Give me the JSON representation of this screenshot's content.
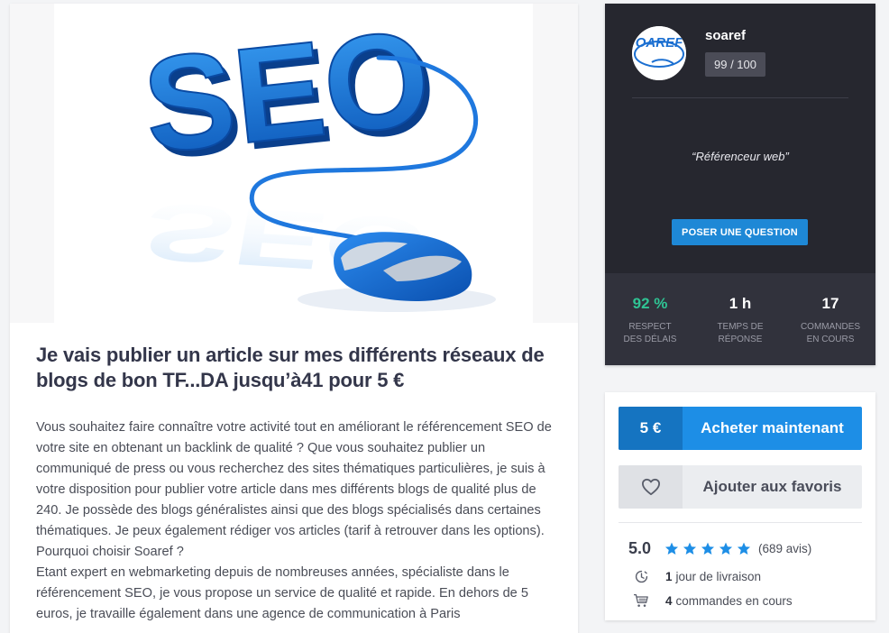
{
  "gig": {
    "image_text": "SEO",
    "title": "Je vais publier un article sur mes différents réseaux de blogs de bon TF...DA jusqu’à41 pour 5 €",
    "description": [
      "Vous souhaitez faire connaître votre activité tout en améliorant le référencement SEO de votre site en obtenant un backlink de qualité ? Que vous souhaitez publier un communiqué de press ou vous recherchez des sites thématiques particulières, je suis à votre disposition pour publier votre article dans mes différents blogs de qualité plus de 240. Je possède des blogs généralistes ainsi que des blogs spécialisés dans certaines thématiques. Je peux également rédiger vos articles (tarif à retrouver dans les options).",
      "Pourquoi choisir Soaref ?",
      "Etant expert en webmarketing depuis de nombreuses années, spécialiste dans le référencement SEO, je vous propose un service de qualité et rapide. En dehors de 5 euros, je travaille également dans une agence de communication à Paris"
    ]
  },
  "seller": {
    "name": "soaref",
    "avatar_text": "OAREF",
    "score": "99 / 100",
    "tagline": "“Référenceur web”",
    "ask_button": "POSER UNE QUESTION",
    "stats": [
      {
        "value": "92 %",
        "label_line1": "RESPECT",
        "label_line2": "DES DÉLAIS"
      },
      {
        "value": "1 h",
        "label_line1": "TEMPS DE",
        "label_line2": "RÉPONSE"
      },
      {
        "value": "17",
        "label_line1": "COMMANDES",
        "label_line2": "EN COURS"
      }
    ]
  },
  "order": {
    "price": "5 €",
    "buy_label": "Acheter maintenant",
    "favorite_label": "Ajouter aux favoris",
    "rating": "5.0",
    "stars": 5,
    "reviews": "(689 avis)",
    "delivery_value": "1",
    "delivery_label": "jour de livraison",
    "orders_value": "4",
    "orders_label": "commandes en cours"
  },
  "colors": {
    "accent_blue": "#1d8ee6",
    "dark_blue": "#1574c1",
    "green": "#2fc494",
    "sidebar_dark": "#26272f"
  },
  "icons": [
    "heart-icon",
    "star-icon",
    "clock-icon",
    "cart-icon",
    "mouse-icon"
  ]
}
